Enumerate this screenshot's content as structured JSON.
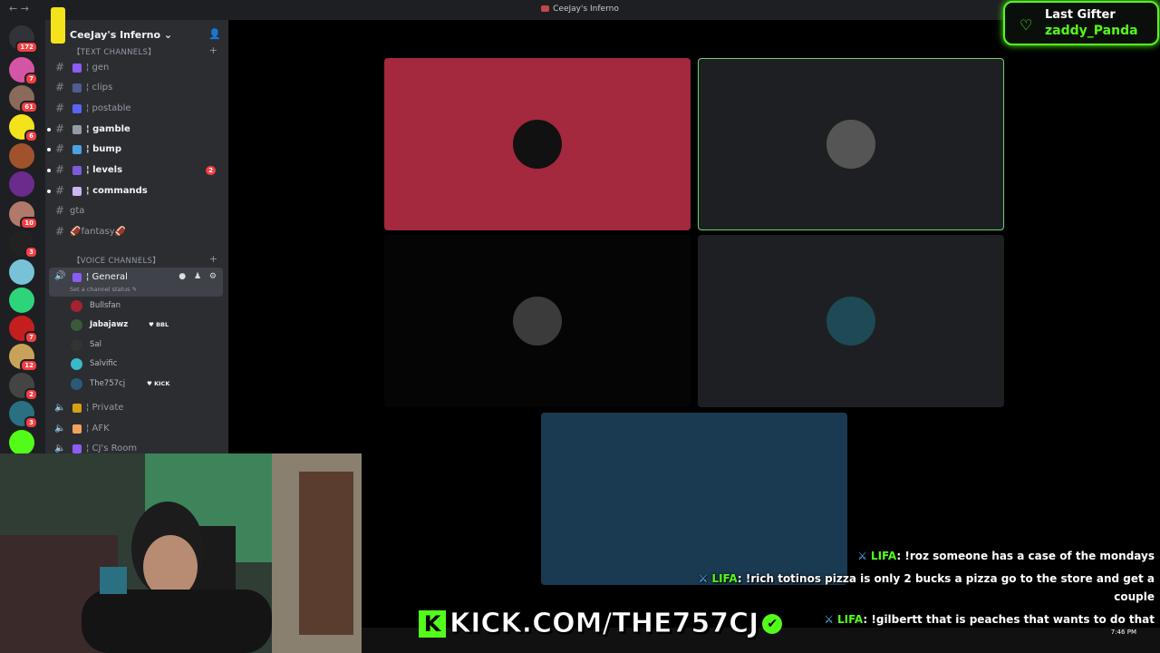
{
  "window": {
    "title": "CeeJay's Inferno",
    "back": "←",
    "forward": "→"
  },
  "servers": [
    {
      "name": "discord-home",
      "badge": "172",
      "color": "#313338"
    },
    {
      "name": "server-2",
      "badge": "7",
      "color": "#d455a6"
    },
    {
      "name": "server-3",
      "badge": "61",
      "color": "#8a6a58"
    },
    {
      "name": "server-4",
      "badge": "6",
      "color": "#f4e21b"
    },
    {
      "name": "server-5",
      "badge": "",
      "color": "#a0522d"
    },
    {
      "name": "server-6",
      "badge": "",
      "color": "#6b2b8c"
    },
    {
      "name": "server-7",
      "badge": "10",
      "color": "#b07a6a"
    },
    {
      "name": "server-8",
      "badge": "3",
      "color": "#222"
    },
    {
      "name": "server-9",
      "badge": "",
      "color": "#78c2d8"
    },
    {
      "name": "server-10",
      "badge": "",
      "color": "#2ed47a"
    },
    {
      "name": "server-11",
      "badge": "7",
      "color": "#c41e1e"
    },
    {
      "name": "server-12",
      "badge": "12",
      "color": "#c9a25a"
    },
    {
      "name": "server-13",
      "badge": "2",
      "color": "#444"
    },
    {
      "name": "server-14",
      "badge": "3",
      "color": "#2a6f82"
    },
    {
      "name": "server-15",
      "badge": "",
      "color": "#53fc18"
    }
  ],
  "sidebar": {
    "server_name": "CeeJay's Inferno",
    "text_category": "【TEXT CHANNELS】",
    "voice_category": "【VOICE CHANNELS】",
    "channels": [
      {
        "label": "¦ gen",
        "unread": false,
        "color": "#8b5cf6"
      },
      {
        "label": "¦ clips",
        "unread": false,
        "color": "#4e5d94"
      },
      {
        "label": "¦ postable",
        "unread": false,
        "color": "#5865f2"
      },
      {
        "label": "¦ gamble",
        "unread": true,
        "color": "#949ba4"
      },
      {
        "label": "¦ bump",
        "unread": true,
        "color": "#4aa3df"
      },
      {
        "label": "¦ levels",
        "unread": true,
        "color": "#7c5cdb",
        "count": "2"
      },
      {
        "label": "¦ commands",
        "unread": true,
        "color": "#c9b6f2"
      },
      {
        "label": "gta",
        "unread": false,
        "color": ""
      },
      {
        "label": "🏈fantasy🏈",
        "unread": false,
        "color": ""
      }
    ],
    "general": {
      "label": "¦ General",
      "status": "Set a channel status ✎",
      "tools": "● ♟ ⚙"
    },
    "voice_users": [
      {
        "name": "Bullsfan",
        "bold": false,
        "tag": "",
        "color": "#a4232f"
      },
      {
        "name": "Jabajawz",
        "bold": true,
        "tag": "♥ BBL",
        "color": "#3a5a3a"
      },
      {
        "name": "Sal",
        "bold": false,
        "tag": "",
        "color": "#333"
      },
      {
        "name": "Salvific",
        "bold": false,
        "tag": "",
        "color": "#3bb9c9"
      },
      {
        "name": "The757cj",
        "bold": false,
        "tag": "♥ KICK",
        "color": "#2a5a77"
      }
    ],
    "other_voice": [
      {
        "label": "¦ Private",
        "color": "#d4a017"
      },
      {
        "label": "¦ AFK",
        "color": "#f0a35e"
      },
      {
        "label": "¦ CJ's Room",
        "color": "#8b5cf6"
      }
    ]
  },
  "tiles": [
    {
      "name": "bullsfan-tile",
      "bg": "#a4283e",
      "avatar": "#111",
      "ring": ""
    },
    {
      "name": "jabajawz-tile",
      "bg": "#1e1f22",
      "avatar": "#555",
      "ring": "#6fd36f"
    },
    {
      "name": "sal-tile",
      "bg": "#050505",
      "avatar": "#3b3b3b",
      "ring": ""
    },
    {
      "name": "salvific-tile",
      "bg": "#1e1f22",
      "avatar": "#1d4a55",
      "ring": ""
    },
    {
      "name": "the757cj-tile",
      "bg": "#1a3a52",
      "avatar": "#1a3a52",
      "ring": ""
    }
  ],
  "gifter": {
    "title": "Last Gifter",
    "name": "zaddy_Panda"
  },
  "chat": [
    {
      "user": "LIFA",
      "msg": ": !roz someone has a case of the mondays"
    },
    {
      "user": "LIFA",
      "msg": ": !rich totinos pizza is only 2 bucks a pizza go to the store and get a"
    },
    {
      "user": "",
      "msg": "couple"
    },
    {
      "user": "LIFA",
      "msg": ": !gilbertt that is peaches that wants to do that"
    },
    {
      "user": "LIFA",
      "msg": ": !gilbertt that is peaches that wants to do that"
    }
  ],
  "kick": {
    "url": "KICK.COM/THE757CJ",
    "k": "K",
    "check": "✔"
  },
  "clock": "7:46 PM"
}
